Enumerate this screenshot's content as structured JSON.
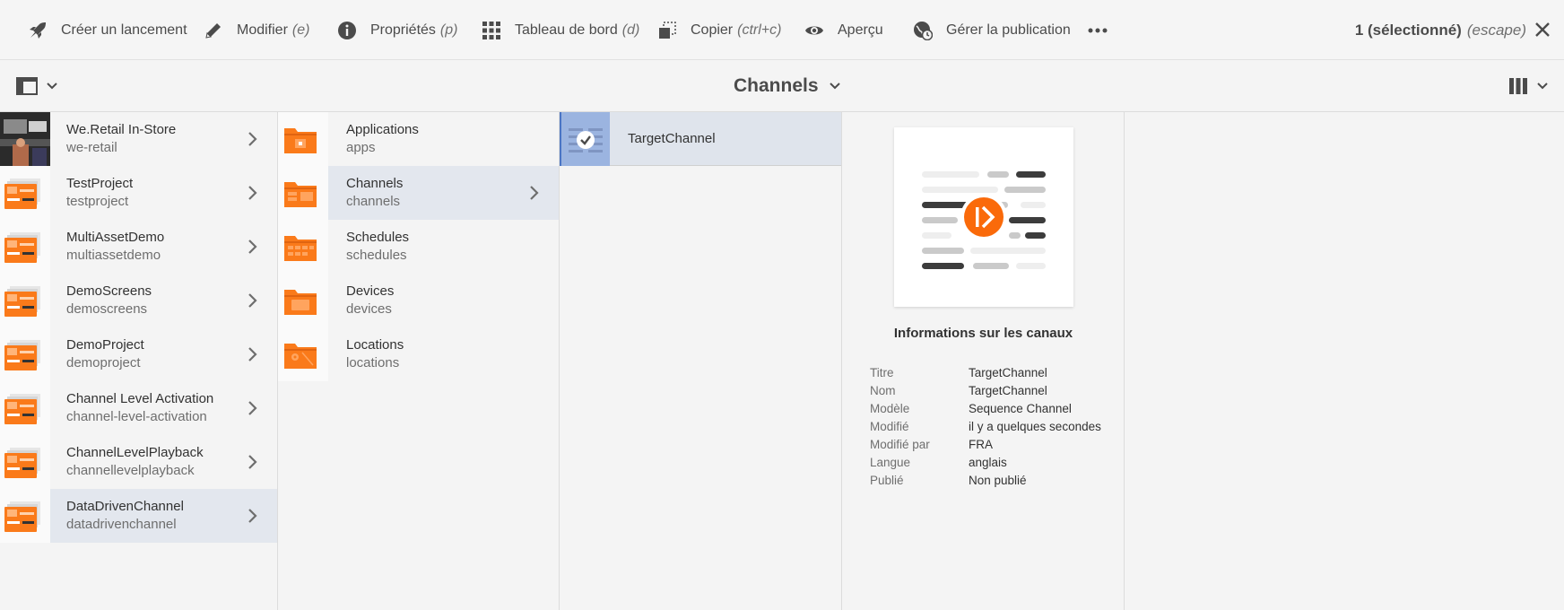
{
  "actionbar": {
    "actions": [
      {
        "label": "Créer un lancement",
        "hint": ""
      },
      {
        "label": "Modifier",
        "hint": "(e)"
      },
      {
        "label": "Propriétés",
        "hint": "(p)"
      },
      {
        "label": "Tableau de bord",
        "hint": "(d)"
      },
      {
        "label": "Copier",
        "hint": "(ctrl+c)"
      },
      {
        "label": "Aperçu",
        "hint": ""
      },
      {
        "label": "Gérer la publication",
        "hint": ""
      }
    ],
    "more_icon": "ellipsis-icon",
    "selection": {
      "count": "1 (sélectionné)",
      "hint": "(escape)"
    }
  },
  "titlebar": {
    "title": "Channels"
  },
  "column1": {
    "items": [
      {
        "title": "We.Retail In-Store",
        "name": "we-retail"
      },
      {
        "title": "TestProject",
        "name": "testproject"
      },
      {
        "title": "MultiAssetDemo",
        "name": "multiassetdemo"
      },
      {
        "title": "DemoScreens",
        "name": "demoscreens"
      },
      {
        "title": "DemoProject",
        "name": "demoproject"
      },
      {
        "title": "Channel Level Activation",
        "name": "channel-level-activation"
      },
      {
        "title": "ChannelLevelPlayback",
        "name": "channellevelplayback"
      },
      {
        "title": "DataDrivenChannel",
        "name": "datadrivenchannel"
      }
    ]
  },
  "column2": {
    "items": [
      {
        "title": "Applications",
        "name": "apps"
      },
      {
        "title": "Channels",
        "name": "channels"
      },
      {
        "title": "Schedules",
        "name": "schedules"
      },
      {
        "title": "Devices",
        "name": "devices"
      },
      {
        "title": "Locations",
        "name": "locations"
      }
    ]
  },
  "column3": {
    "items": [
      {
        "title": "TargetChannel"
      }
    ]
  },
  "details": {
    "heading": "Informations sur les canaux",
    "properties": [
      {
        "key": "Titre",
        "value": "TargetChannel"
      },
      {
        "key": "Nom",
        "value": "TargetChannel"
      },
      {
        "key": "Modèle",
        "value": "Sequence Channel"
      },
      {
        "key": "Modifié",
        "value": "il y a quelques secondes"
      },
      {
        "key": "Modifié par",
        "value": "FRA"
      },
      {
        "key": "Langue",
        "value": "anglais"
      },
      {
        "key": "Publié",
        "value": "Non publié"
      }
    ]
  },
  "colors": {
    "accent_orange": "#fa7a1a",
    "selected_row": "#e3e7ee",
    "selected_thumb": "#9bb4e0"
  }
}
